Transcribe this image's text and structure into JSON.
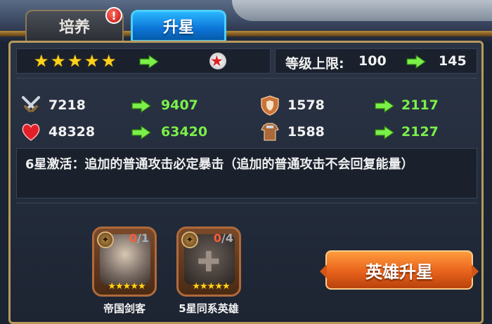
{
  "tabs": [
    {
      "label": "培养",
      "active": false,
      "alert": true
    },
    {
      "label": "升星",
      "active": true
    }
  ],
  "alert_symbol": "!",
  "star_row": {
    "current_stars": 5,
    "next_star_color": "#e02020"
  },
  "level_cap": {
    "label": "等级上限:",
    "current": "100",
    "next": "145"
  },
  "stats": [
    {
      "icon": "crossed-swords-icon",
      "current": "7218",
      "next": "9407"
    },
    {
      "icon": "shield-icon",
      "current": "1578",
      "next": "2117"
    },
    {
      "icon": "heart-icon",
      "current": "48328",
      "next": "63420"
    },
    {
      "icon": "armor-icon",
      "current": "1588",
      "next": "2127"
    }
  ],
  "activation_text": "6星激活：追加的普通攻击必定暴击（追加的普通攻击不会回复能量）",
  "materials": [
    {
      "name": "帝国剑客",
      "have": "0",
      "need": "/1",
      "stars": "★★★★★"
    },
    {
      "name": "5星同系英雄",
      "have": "0",
      "need": "/4",
      "stars": "★★★★★"
    }
  ],
  "upgrade_button": "英雄升星",
  "colors": {
    "accent_green": "#7bf04a",
    "star_gold": "#ffd21a",
    "button_orange": "#e8621c",
    "tab_blue": "#0c74d6"
  }
}
